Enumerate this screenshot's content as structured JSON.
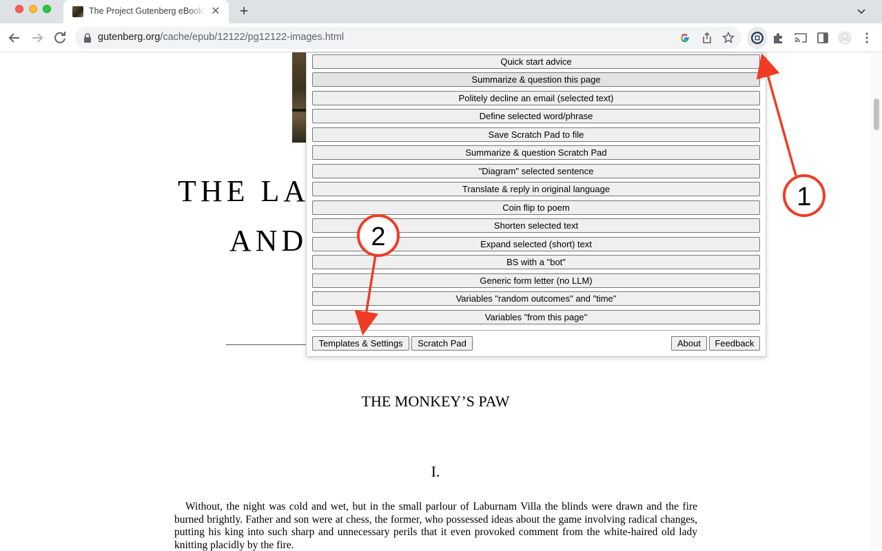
{
  "browser": {
    "tab_title": "The Project Gutenberg eBook of",
    "new_tab_label": "+",
    "url_host": "gutenberg.org",
    "url_path": "/cache/epub/12122/pg12122-images.html"
  },
  "page": {
    "title_line_1": "THE LA",
    "title_line_2": "AND",
    "story_title": "THE MONKEY’S PAW",
    "chapter": "I.",
    "paragraph": "Without, the night was cold and wet, but in the small parlour of Laburnam Villa the blinds were drawn and the fire burned brightly. Father and son were at chess, the former, who possessed ideas about the game involving radical changes, putting his king into such sharp and unnecessary perils that it even provoked comment from the white-haired old lady knitting placidly by the fire."
  },
  "popup": {
    "menu_items": [
      "Quick start advice",
      "Summarize & question this page",
      "Politely decline an email (selected text)",
      "Define selected word/phrase",
      "Save Scratch Pad to file",
      "Summarize & question Scratch Pad",
      "\"Diagram\" selected sentence",
      "Translate & reply in original language",
      "Coin flip to poem",
      "Shorten selected text",
      "Expand selected (short) text",
      "BS with a \"bot\"",
      "Generic form letter (no LLM)",
      "Variables \"random outcomes\" and \"time\"",
      "Variables \"from this page\""
    ],
    "templates_settings": "Templates & Settings",
    "scratch_pad": "Scratch Pad",
    "about": "About",
    "feedback": "Feedback"
  },
  "annotations": {
    "callout_1": "1",
    "callout_2": "2",
    "arrow_color": "#f03c24"
  }
}
